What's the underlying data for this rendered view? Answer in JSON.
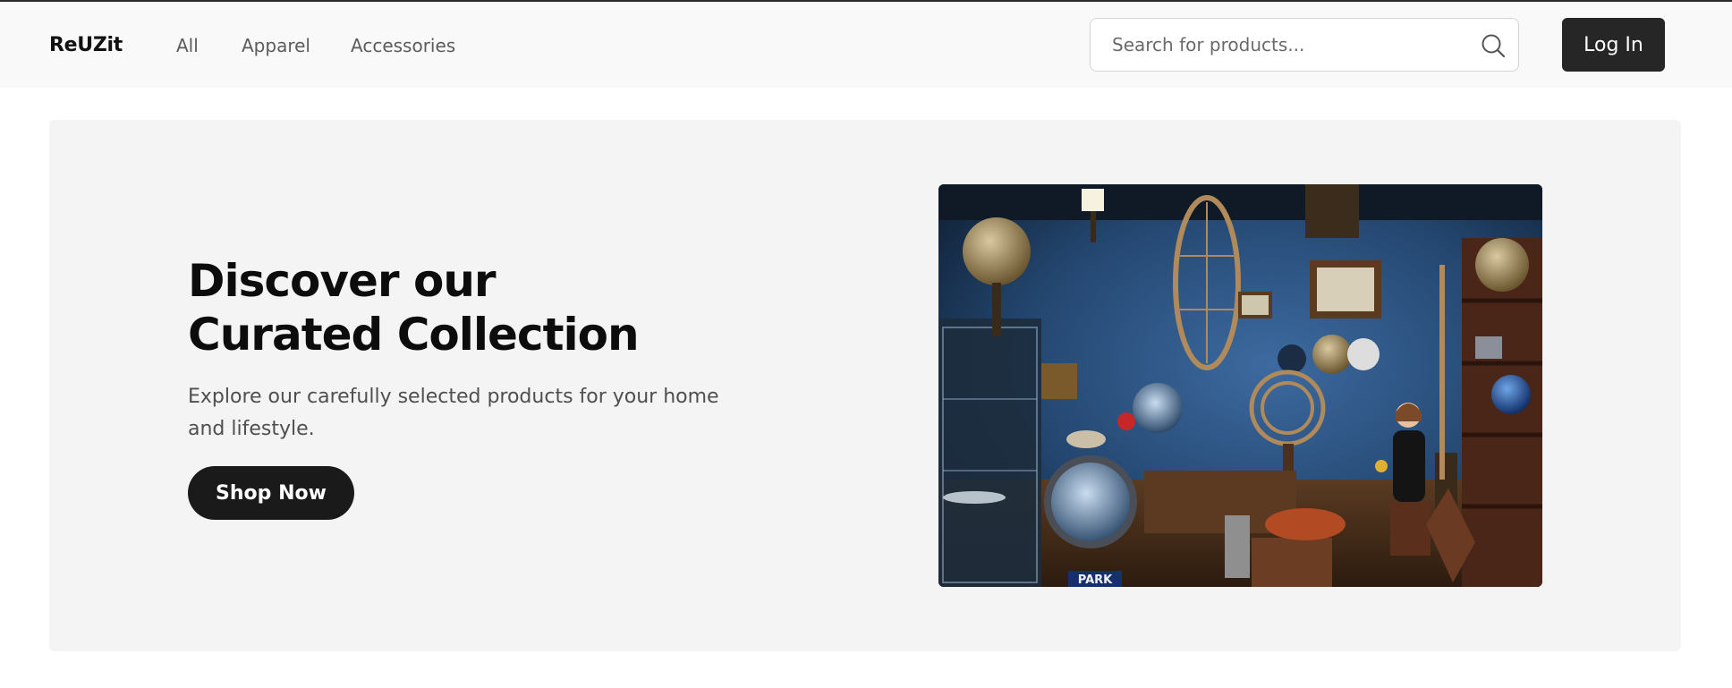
{
  "brand": {
    "name": "ReUZit"
  },
  "nav": {
    "links": [
      {
        "label": "All"
      },
      {
        "label": "Apparel"
      },
      {
        "label": "Accessories"
      }
    ]
  },
  "search": {
    "placeholder": "Search for products...",
    "value": "",
    "icon": "search-icon"
  },
  "auth": {
    "login_label": "Log In"
  },
  "hero": {
    "title_line1": "Discover our",
    "title_line2": "Curated Collection",
    "subtitle": "Explore our carefully selected products for your home and lifestyle.",
    "cta_label": "Shop Now",
    "image_sign": "PARK"
  },
  "colors": {
    "navbar_bg": "#f9f9f9",
    "hero_bg": "#f4f4f4",
    "button_dark": "#1a1a1a",
    "login_bg": "#262626",
    "nav_text": "#5c5c5c"
  }
}
